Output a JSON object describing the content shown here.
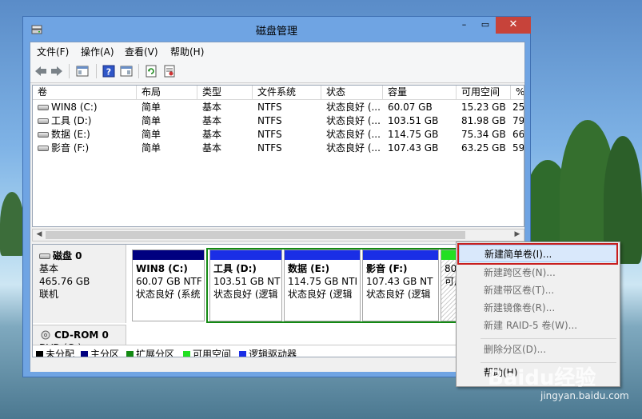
{
  "window": {
    "title": "磁盘管理",
    "minimize_glyph": "–",
    "maximize_glyph": "▭",
    "close_glyph": "✕"
  },
  "menu": [
    "文件(F)",
    "操作(A)",
    "查看(V)",
    "帮助(H)"
  ],
  "toolbar": {
    "icons": [
      "back-arrow-icon",
      "forward-arrow-icon",
      "panel-icon",
      "help-icon",
      "panel-icon",
      "refresh-icon",
      "properties-icon"
    ]
  },
  "volume_table": {
    "columns": [
      "卷",
      "布局",
      "类型",
      "文件系统",
      "状态",
      "容量",
      "可用空间",
      "%"
    ],
    "rows": [
      {
        "name": "WIN8 (C:)",
        "layout": "简单",
        "type": "基本",
        "fs": "NTFS",
        "status": "状态良好 (...",
        "capacity": "60.07 GB",
        "free": "15.23 GB",
        "pct": "25"
      },
      {
        "name": "工具 (D:)",
        "layout": "简单",
        "type": "基本",
        "fs": "NTFS",
        "status": "状态良好 (...",
        "capacity": "103.51 GB",
        "free": "81.98 GB",
        "pct": "79"
      },
      {
        "name": "数据 (E:)",
        "layout": "简单",
        "type": "基本",
        "fs": "NTFS",
        "status": "状态良好 (...",
        "capacity": "114.75 GB",
        "free": "75.34 GB",
        "pct": "66"
      },
      {
        "name": "影音 (F:)",
        "layout": "简单",
        "type": "基本",
        "fs": "NTFS",
        "status": "状态良好 (...",
        "capacity": "107.43 GB",
        "free": "63.25 GB",
        "pct": "59"
      }
    ]
  },
  "disks": [
    {
      "name": "磁盘 0",
      "type": "基本",
      "size": "465.76 GB",
      "state": "联机",
      "partitions": [
        {
          "title": "WIN8  (C:)",
          "size": "60.07 GB NTF",
          "status": "状态良好 (系统"
        },
        {
          "title": "工具  (D:)",
          "size": "103.51 GB NT",
          "status": "状态良好 (逻辑"
        },
        {
          "title": "数据  (E:)",
          "size": "114.75 GB NTI",
          "status": "状态良好 (逻辑"
        },
        {
          "title": "影音  (F:)",
          "size": "107.43 GB NT",
          "status": "状态良好 (逻辑"
        },
        {
          "title": "",
          "size": "80.0",
          "status": "可用"
        }
      ]
    },
    {
      "name": "CD-ROM 0",
      "type": "DVD (G:)"
    }
  ],
  "legend": [
    {
      "label": "未分配",
      "color": "#000000"
    },
    {
      "label": "主分区",
      "color": "#000080"
    },
    {
      "label": "扩展分区",
      "color": "#138a13"
    },
    {
      "label": "可用空间",
      "color": "#22e022"
    },
    {
      "label": "逻辑驱动器",
      "color": "#1a2ee6"
    }
  ],
  "context_menu": {
    "items": [
      {
        "label": "新建简单卷(I)...",
        "enabled": true
      },
      {
        "label": "新建跨区卷(N)...",
        "enabled": false
      },
      {
        "label": "新建带区卷(T)...",
        "enabled": false
      },
      {
        "label": "新建镜像卷(R)...",
        "enabled": false
      },
      {
        "label": "新建 RAID-5 卷(W)...",
        "enabled": false
      },
      {
        "label": "删除分区(D)...",
        "enabled": false
      },
      {
        "label": "帮助(H)",
        "enabled": true
      }
    ]
  },
  "watermark": {
    "logo": "Baidu经验",
    "url": "jingyan.baidu.com"
  },
  "colors": {
    "primary": "#000080",
    "logical": "#1a2ee6",
    "extended": "#138a13",
    "free": "#22e022",
    "highlight": "#c81e1e"
  }
}
